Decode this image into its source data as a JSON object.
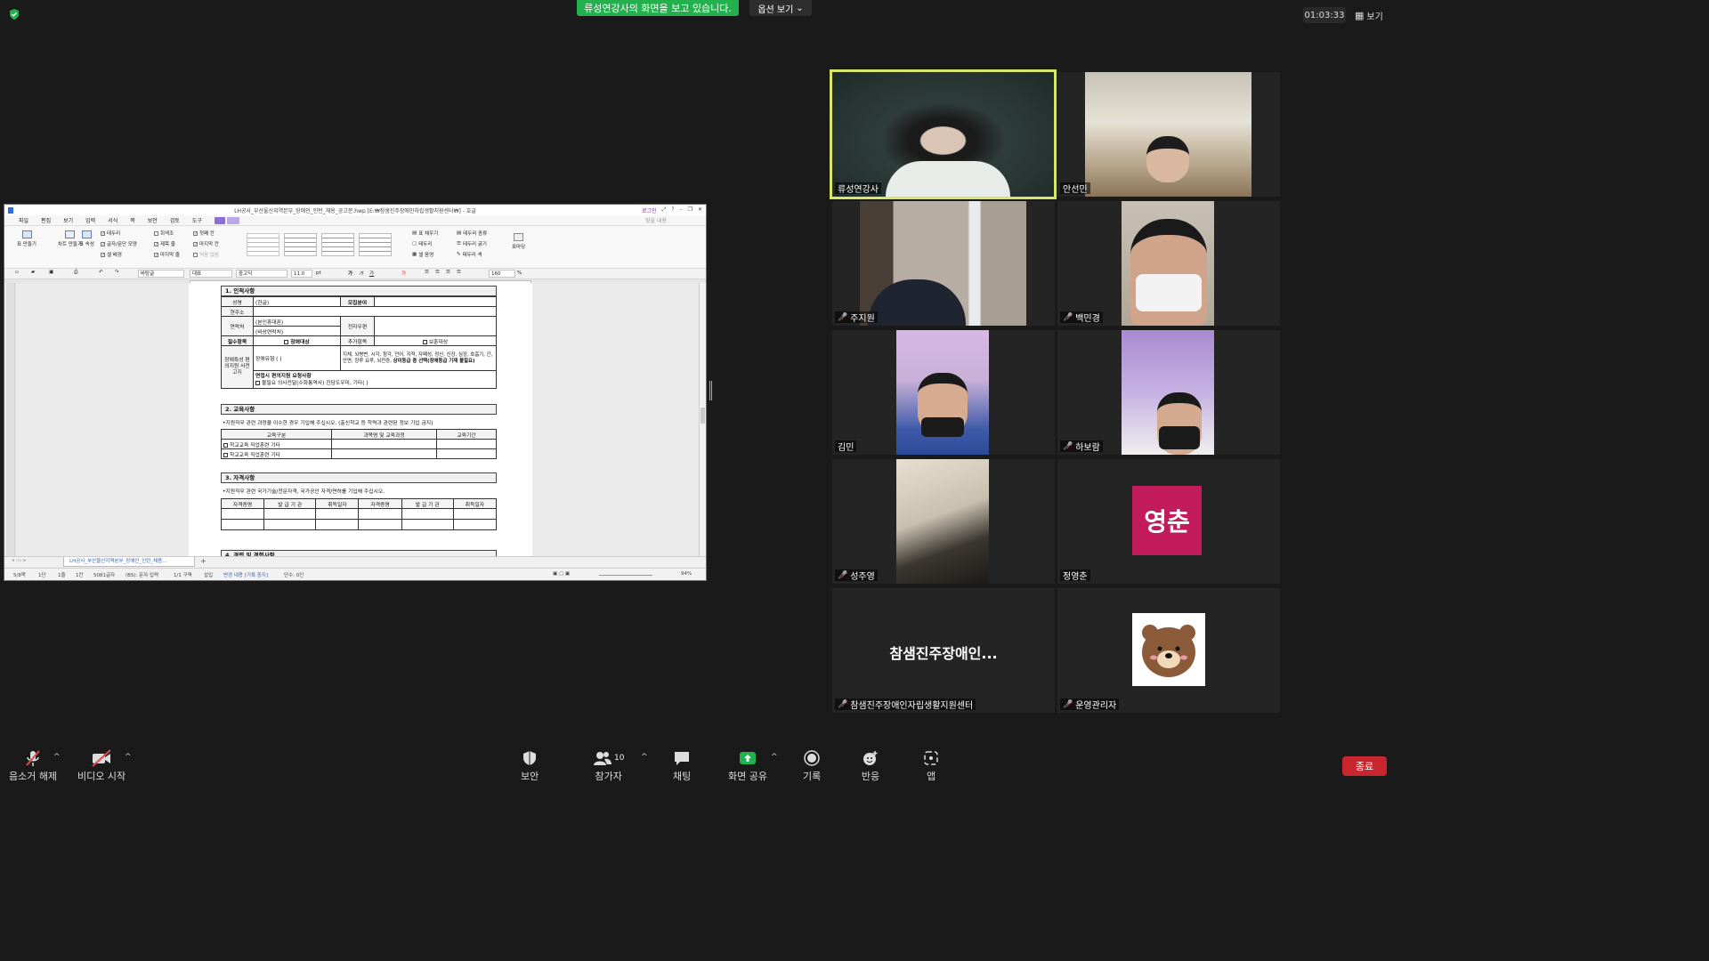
{
  "top": {
    "share_banner": "류성연강사의 화면을 보고 있습니다.",
    "view_options": "옵션 보기",
    "timer": "01:03:33",
    "view_button": "보기"
  },
  "hwp": {
    "title": "LH공사_부산울산지역본부_장애인_인턴_채용_공고문.hwp [E:₩참샘진주장애인자립생활지원센터₩] - 호글",
    "login": "로그인",
    "menu": [
      "파일",
      "편집",
      "보기",
      "입력",
      "서식",
      "쪽",
      "보안",
      "검토",
      "도구"
    ],
    "find_placeholder": "찾을 내용",
    "ribbon": {
      "table_make": "표 만들기",
      "chart_make": "차트 만들기",
      "table_prop": "표 속성",
      "checks_col1": [
        "테두리",
        "글자/문단 모양",
        "셀 배경"
      ],
      "checks_col2": [
        "회색조",
        "제목 줄",
        "마지막 줄"
      ],
      "checks_col3": [
        "첫째 칸",
        "마지막 칸",
        "처음 없음"
      ],
      "right_items": [
        "표 채우기",
        "테두리",
        "셀 음영"
      ],
      "right_items2": [
        "테두리 종류",
        "테두리 굵기",
        "테두리 색"
      ],
      "table_roll": "표마당"
    },
    "fmt": {
      "style": "바탕글",
      "para": "대표",
      "font": "중고딕",
      "size": "11.0",
      "unit": "pt",
      "zoom": "160",
      "pct": "%"
    },
    "doc": {
      "s1": "1. 인적사항",
      "name_label": "성명",
      "name_value": "(한글)",
      "recruit_field": "모집분야",
      "address": "현주소",
      "contact": "연락처",
      "contact_mobile": "(본인휴대폰)",
      "contact_emergency": "(비상연락처)",
      "email": "전자우편",
      "required": "필수항목",
      "disabled_target": "장애대상",
      "additional": "추가항목",
      "veteran_target": "보훈대상",
      "disability_label": "장애특성 편의지원 사전고지",
      "disability_grade": "장애유형 (          )",
      "disability_types": "지체, 뇌병변, 시각, 청각, 언어, 지적, 자폐성, 정신, 신장, 심장, 호흡기, 간, 안면, 장루 요루, 뇌전증,",
      "disability_note": "상이등급 중 선택(장애등급 기재 불필요)",
      "interview_title": "면접시 편의지원 요청사항",
      "interview_opts": "불필요  의사전달(수화통역사)  진담도우미, 기타(          )",
      "s2": "2. 교육사항",
      "s2_note": "•지원직무 관련 과정을 이수한 경우 기입해 주십시오. (출신학교 등 학력과 관련된 정보 기입 금지)",
      "edu_h1": "교육구분",
      "edu_h2": "과목명 및 교육과정",
      "edu_h3": "교육기간",
      "edu_row": "학교교육  직업훈련  기타",
      "s3": "3. 자격사항",
      "s3_note": "•지원직무 관련 국가기술/전문자격, 국가공인 자격/면허를 기입해 주십시오.",
      "cert_h1": "자격증명",
      "cert_h2": "발 급 기 관",
      "cert_h3": "취득일자",
      "s4": "4. 경력 및 경험사항"
    },
    "doc_tab": "LH공사_부산울산지역본부_장애인_인턴_채용...",
    "status": {
      "page": "5/8쪽",
      "section": "1단",
      "line": "1줄",
      "col": "1칸",
      "chars": "5081글자",
      "mode": "(BS): 문자 입력",
      "zone": "1/1 구역",
      "insert": "삽입",
      "track": "변경 내용 [기록 중지]",
      "author": "단수: 0인",
      "zoom": "94%"
    }
  },
  "participants": [
    {
      "name": "류성연강사",
      "muted": false,
      "speaking": true
    },
    {
      "name": "안선민",
      "muted": false,
      "speaking": false
    },
    {
      "name": "주지원",
      "muted": true,
      "speaking": false
    },
    {
      "name": "백민경",
      "muted": true,
      "speaking": false
    },
    {
      "name": "김민",
      "muted": false,
      "speaking": false
    },
    {
      "name": "하보람",
      "muted": true,
      "speaking": false
    },
    {
      "name": "성주영",
      "muted": true,
      "speaking": false
    },
    {
      "name": "정영춘",
      "muted": false,
      "speaking": false,
      "avatar_text": "영춘",
      "avatar_color": "#c21c5c"
    },
    {
      "name": "참샘진주장애인자립생활지원센터",
      "muted": true,
      "speaking": false,
      "display_text": "참샘진주장애인..."
    },
    {
      "name": "운영관리자",
      "muted": true,
      "speaking": false
    }
  ],
  "toolbar": {
    "mic": "음소거 해제",
    "video": "비디오 시작",
    "security": "보안",
    "participants": "참가자",
    "participants_count": "10",
    "chat": "채팅",
    "share": "화면 공유",
    "record": "기록",
    "reactions": "반응",
    "apps": "앱",
    "end": "종료"
  },
  "colors": {
    "share_banner": "#23b14d",
    "speaker_border": "#d7e56a",
    "end_button": "#c8262e",
    "muted_icon": "#e5484d"
  }
}
